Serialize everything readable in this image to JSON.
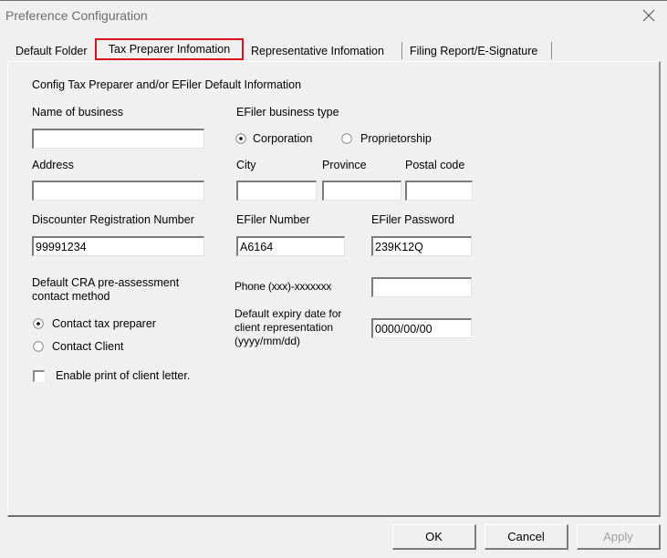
{
  "window": {
    "title": "Preference Configuration",
    "close_icon": "close-x-icon"
  },
  "tabs": [
    {
      "label": "Default Folder",
      "active": false
    },
    {
      "label": "Tax Preparer Infomation",
      "active": true
    },
    {
      "label": "Representative Infomation",
      "active": false
    },
    {
      "label": "Filing Report/E-Signature",
      "active": false
    }
  ],
  "form": {
    "section_title": "Config Tax Preparer and/or EFiler Default Information",
    "name_of_business": {
      "label": "Name of business",
      "value": ""
    },
    "address": {
      "label": "Address",
      "value": ""
    },
    "efiler_business_type": {
      "label": "EFiler business type",
      "options": [
        {
          "label": "Corporation",
          "selected": true
        },
        {
          "label": "Proprietorship",
          "selected": false
        }
      ]
    },
    "city": {
      "label": "City",
      "value": ""
    },
    "province": {
      "label": "Province",
      "value": ""
    },
    "postal_code": {
      "label": "Postal code",
      "value": ""
    },
    "discounter_registration_number": {
      "label": "Discounter Registration Number",
      "value": "99991234"
    },
    "efiler_number": {
      "label": "EFiler Number",
      "value": "A6164"
    },
    "efiler_password": {
      "label": "EFiler Password",
      "value": "239K12Q"
    },
    "contact_method": {
      "label": "Default CRA pre-assessment contact method",
      "options": [
        {
          "label": "Contact tax preparer",
          "selected": true
        },
        {
          "label": "Contact Client",
          "selected": false
        }
      ]
    },
    "phone": {
      "label": "Phone (xxx)-xxxxxxx",
      "value": ""
    },
    "expiry_date": {
      "label": "Default expiry date for client representation (yyyy/mm/dd)",
      "value": "0000/00/00"
    },
    "enable_print_letter": {
      "label": "Enable print of client letter.",
      "checked": false
    }
  },
  "buttons": {
    "ok": "OK",
    "cancel": "Cancel",
    "apply": "Apply",
    "apply_enabled": false
  },
  "colors": {
    "active_tab_highlight": "#d9131d",
    "background": "#f0f0f0"
  }
}
